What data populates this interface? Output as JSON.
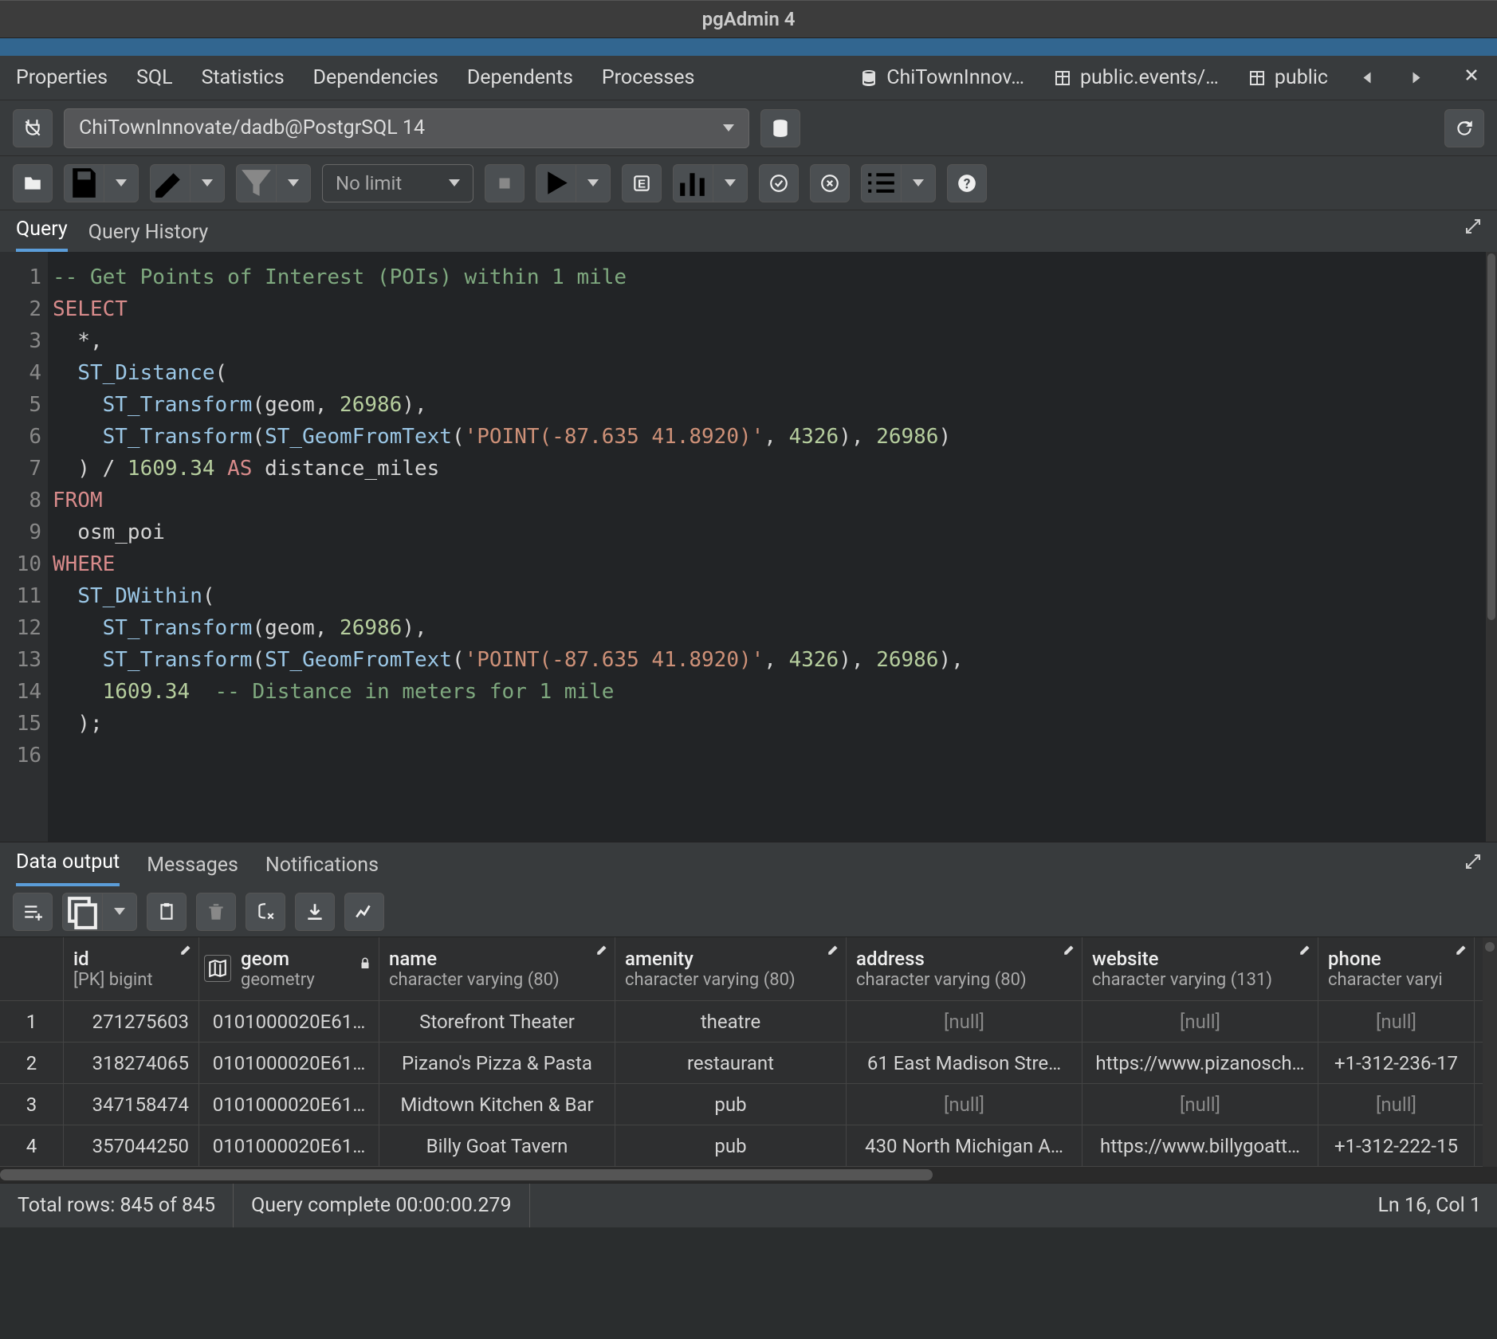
{
  "title": "pgAdmin 4",
  "menubar": {
    "items": [
      "Properties",
      "SQL",
      "Statistics",
      "Dependencies",
      "Dependents",
      "Processes"
    ],
    "open_tabs": [
      {
        "icon": "database",
        "label": "ChiTownInnov…"
      },
      {
        "icon": "table",
        "label": "public.events/…"
      },
      {
        "icon": "table",
        "label": "public"
      }
    ]
  },
  "connection": {
    "selected": "ChiTownInnovate/dadb@PostgrSQL 14"
  },
  "toolbar": {
    "limit_label": "No limit"
  },
  "query_tabs": {
    "tabs": [
      "Query",
      "Query History"
    ],
    "active": 0
  },
  "editor": {
    "lines": [
      {
        "n": "1",
        "tokens": [
          {
            "t": "-- Get Points of Interest (POIs) within 1 mile",
            "c": "comment"
          }
        ]
      },
      {
        "n": "2",
        "tokens": [
          {
            "t": "SELECT",
            "c": "key"
          }
        ]
      },
      {
        "n": "3",
        "tokens": [
          {
            "t": "  *,",
            "c": "ident"
          }
        ]
      },
      {
        "n": "4",
        "tokens": [
          {
            "t": "  ",
            "c": "ident"
          },
          {
            "t": "ST_Distance",
            "c": "func"
          },
          {
            "t": "(",
            "c": "ident"
          }
        ]
      },
      {
        "n": "5",
        "tokens": [
          {
            "t": "    ",
            "c": "ident"
          },
          {
            "t": "ST_Transform",
            "c": "func"
          },
          {
            "t": "(geom, ",
            "c": "ident"
          },
          {
            "t": "26986",
            "c": "num"
          },
          {
            "t": "),",
            "c": "ident"
          }
        ]
      },
      {
        "n": "6",
        "tokens": [
          {
            "t": "    ",
            "c": "ident"
          },
          {
            "t": "ST_Transform",
            "c": "func"
          },
          {
            "t": "(",
            "c": "ident"
          },
          {
            "t": "ST_GeomFromText",
            "c": "func"
          },
          {
            "t": "(",
            "c": "ident"
          },
          {
            "t": "'POINT(-87.635 41.8920)'",
            "c": "str"
          },
          {
            "t": ", ",
            "c": "ident"
          },
          {
            "t": "4326",
            "c": "num"
          },
          {
            "t": "), ",
            "c": "ident"
          },
          {
            "t": "26986",
            "c": "num"
          },
          {
            "t": ")",
            "c": "ident"
          }
        ]
      },
      {
        "n": "7",
        "tokens": [
          {
            "t": "  ) / ",
            "c": "ident"
          },
          {
            "t": "1609.34",
            "c": "num"
          },
          {
            "t": " ",
            "c": "ident"
          },
          {
            "t": "AS",
            "c": "key"
          },
          {
            "t": " distance_miles",
            "c": "ident"
          }
        ]
      },
      {
        "n": "8",
        "tokens": [
          {
            "t": "FROM",
            "c": "key"
          }
        ]
      },
      {
        "n": "9",
        "tokens": [
          {
            "t": "  osm_poi",
            "c": "ident"
          }
        ]
      },
      {
        "n": "10",
        "tokens": [
          {
            "t": "WHERE",
            "c": "key"
          }
        ]
      },
      {
        "n": "11",
        "tokens": [
          {
            "t": "  ",
            "c": "ident"
          },
          {
            "t": "ST_DWithin",
            "c": "func"
          },
          {
            "t": "(",
            "c": "ident"
          }
        ]
      },
      {
        "n": "12",
        "tokens": [
          {
            "t": "    ",
            "c": "ident"
          },
          {
            "t": "ST_Transform",
            "c": "func"
          },
          {
            "t": "(geom, ",
            "c": "ident"
          },
          {
            "t": "26986",
            "c": "num"
          },
          {
            "t": "),",
            "c": "ident"
          }
        ]
      },
      {
        "n": "13",
        "tokens": [
          {
            "t": "    ",
            "c": "ident"
          },
          {
            "t": "ST_Transform",
            "c": "func"
          },
          {
            "t": "(",
            "c": "ident"
          },
          {
            "t": "ST_GeomFromText",
            "c": "func"
          },
          {
            "t": "(",
            "c": "ident"
          },
          {
            "t": "'POINT(-87.635 41.8920)'",
            "c": "str"
          },
          {
            "t": ", ",
            "c": "ident"
          },
          {
            "t": "4326",
            "c": "num"
          },
          {
            "t": "), ",
            "c": "ident"
          },
          {
            "t": "26986",
            "c": "num"
          },
          {
            "t": "),",
            "c": "ident"
          }
        ]
      },
      {
        "n": "14",
        "tokens": [
          {
            "t": "    ",
            "c": "ident"
          },
          {
            "t": "1609.34",
            "c": "num"
          },
          {
            "t": "  ",
            "c": "ident"
          },
          {
            "t": "-- Distance in meters for 1 mile",
            "c": "comment"
          }
        ]
      },
      {
        "n": "15",
        "tokens": [
          {
            "t": "  );",
            "c": "ident"
          }
        ]
      },
      {
        "n": "16",
        "tokens": [
          {
            "t": "",
            "c": "ident"
          }
        ]
      }
    ]
  },
  "output_tabs": {
    "tabs": [
      "Data output",
      "Messages",
      "Notifications"
    ],
    "active": 0
  },
  "grid": {
    "columns": [
      {
        "name": "id",
        "type": "[PK] bigint"
      },
      {
        "name": "geom",
        "type": "geometry"
      },
      {
        "name": "name",
        "type": "character varying (80)"
      },
      {
        "name": "amenity",
        "type": "character varying (80)"
      },
      {
        "name": "address",
        "type": "character varying (80)"
      },
      {
        "name": "website",
        "type": "character varying (131)"
      },
      {
        "name": "phone",
        "type": "character varyi"
      }
    ],
    "rows": [
      {
        "n": "1",
        "id": "271275603",
        "geom": "0101000020E61…",
        "name": "Storefront Theater",
        "amenity": "theatre",
        "address": "[null]",
        "website": "[null]",
        "phone": "[null]"
      },
      {
        "n": "2",
        "id": "318274065",
        "geom": "0101000020E61…",
        "name": "Pizano's Pizza & Pasta",
        "amenity": "restaurant",
        "address": "61 East Madison Stre…",
        "website": "https://www.pizanosch…",
        "phone": "+1-312-236-17"
      },
      {
        "n": "3",
        "id": "347158474",
        "geom": "0101000020E61…",
        "name": "Midtown Kitchen & Bar",
        "amenity": "pub",
        "address": "[null]",
        "website": "[null]",
        "phone": "[null]"
      },
      {
        "n": "4",
        "id": "357044250",
        "geom": "0101000020E61…",
        "name": "Billy Goat Tavern",
        "amenity": "pub",
        "address": "430 North Michigan A…",
        "website": "https://www.billygoatt…",
        "phone": "+1-312-222-15"
      }
    ]
  },
  "status": {
    "rows": "Total rows: 845 of 845",
    "timing": "Query complete 00:00:00.279",
    "cursor": "Ln 16, Col 1"
  }
}
